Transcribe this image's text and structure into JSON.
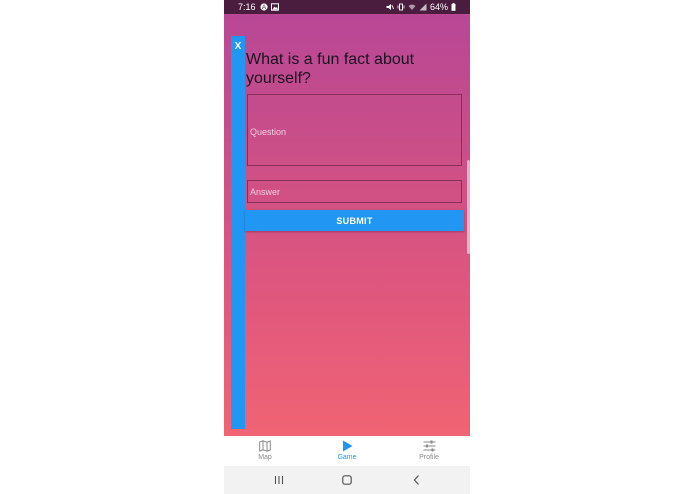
{
  "status_bar": {
    "time": "7:16",
    "battery": "64%"
  },
  "dialog": {
    "close_label": "X",
    "prompt": "What is a fun fact about yourself?",
    "question_placeholder": "Question",
    "answer_placeholder": "Answer",
    "submit_label": "SUBMIT"
  },
  "bottom_nav": {
    "items": [
      {
        "label": "Map",
        "icon": "map-icon"
      },
      {
        "label": "Game",
        "icon": "play-icon"
      },
      {
        "label": "Profile",
        "icon": "sliders-icon"
      }
    ],
    "active": "Game"
  },
  "system_nav": {
    "buttons": [
      "recent-apps-icon",
      "home-icon",
      "back-icon"
    ]
  },
  "colors": {
    "accent": "#2196f3",
    "gradient_top": "#b84796",
    "gradient_bottom": "#f06473",
    "status_bar": "#4a1d3f"
  }
}
